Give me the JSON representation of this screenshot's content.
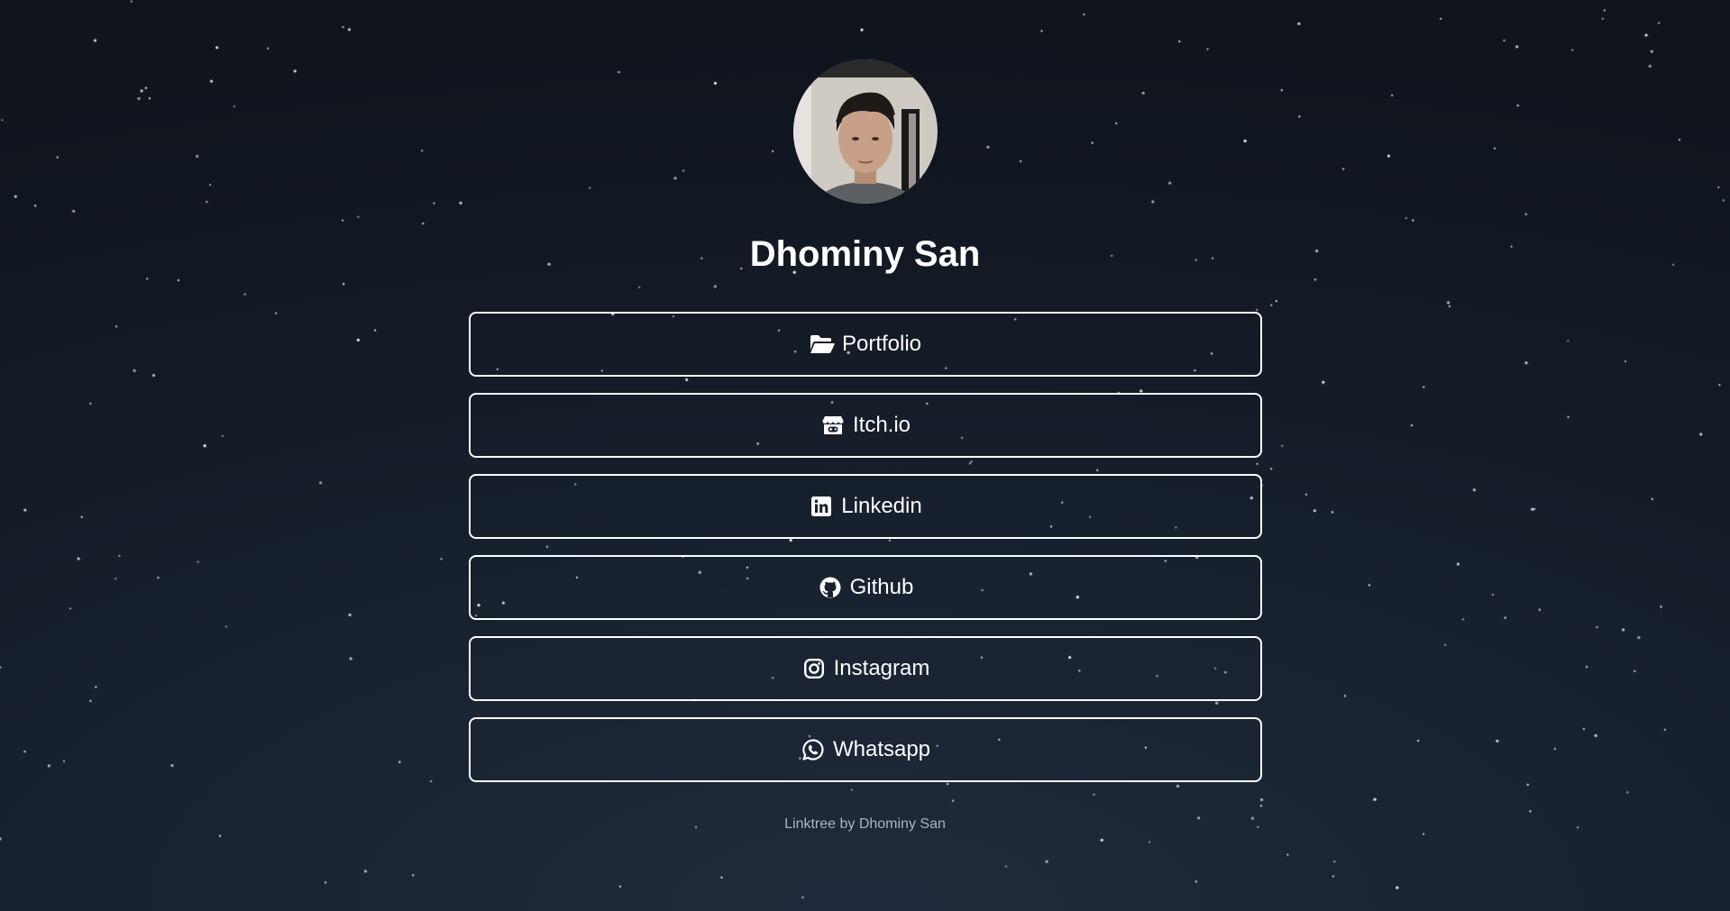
{
  "profile": {
    "name": "Dhominy San",
    "avatar_alt": "Dhominy San"
  },
  "links": [
    {
      "label": "Portfolio",
      "icon": "folder-open-icon"
    },
    {
      "label": "Itch.io",
      "icon": "itchio-icon"
    },
    {
      "label": "Linkedin",
      "icon": "linkedin-icon"
    },
    {
      "label": "Github",
      "icon": "github-icon"
    },
    {
      "label": "Instagram",
      "icon": "instagram-icon"
    },
    {
      "label": "Whatsapp",
      "icon": "whatsapp-icon"
    }
  ],
  "footer": {
    "text": "Linktree by Dhominy San"
  },
  "colors": {
    "background_top": "#0f141d",
    "background_bottom": "#1f2b3c",
    "button_border": "#ffffff",
    "text": "#ffffff",
    "footer_text": "#aab4c2"
  }
}
